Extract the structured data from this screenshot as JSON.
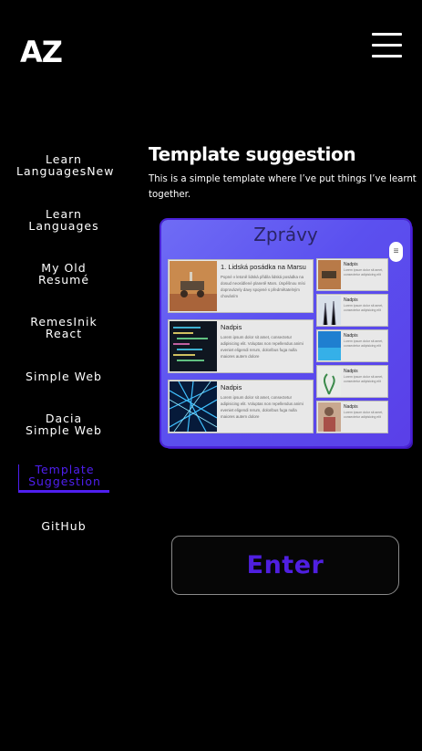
{
  "header": {
    "logo": "AZ",
    "menu_icon": "hamburger-menu-icon"
  },
  "sidenav": {
    "items": [
      {
        "label": "Learn\nLanguagesNew",
        "active": false
      },
      {
        "label": "Learn\nLanguages",
        "active": false
      },
      {
        "label": "My Old\nResumé",
        "active": false
      },
      {
        "label": "RemesInik\nReact",
        "active": false
      },
      {
        "label": "Simple Web",
        "active": false
      },
      {
        "label": "Dacia\nSimple Web",
        "active": false
      },
      {
        "label": "Template\nSuggestion",
        "active": true
      },
      {
        "label": "GitHub",
        "active": false
      }
    ],
    "active_color": "#4f1ff0"
  },
  "main": {
    "title": "Template suggestion",
    "description": "This is a simple template where I’ve put things I’ve learnt together.",
    "preview": {
      "heading": "Zprávy",
      "big_cards": [
        {
          "title": "1. Lidská posádka na Marsu",
          "text": "Popné v letoně lidská přidila lidská posádka na dosud neosídlené planetě Mars. Úspěšnou mísi doprovázely davy spojené s předmětatelným chováním"
        },
        {
          "title": "Nadpis",
          "text": "Lorem ipsum dolor sit amet, consectetur adipisicing elit. Voluptas non repellendus animi eveniet eligendi rerum, doloribus fuga nulla maiores autem dolore"
        },
        {
          "title": "Nadpis",
          "text": "Lorem ipsum dolor sit amet, consectetur adipisicing elit. Voluptas non repellendus animi eveniet eligendi rerum, doloribus fuga nulla maiores autem dolore"
        }
      ],
      "small_cards": [
        {
          "title": "Nadpis",
          "text": "Lorem ipsum dolor sit amet, consectetur adipisicing elit"
        },
        {
          "title": "Nadpis",
          "text": "Lorem ipsum dolor sit amet, consectetur adipisicing elit"
        },
        {
          "title": "Nadpis",
          "text": "Lorem ipsum dolor sit amet, consectetur adipisicing elit"
        },
        {
          "title": "Nadpis",
          "text": "Lorem ipsum dolor sit amet, consectetur adipisicing elit"
        },
        {
          "title": "Nadpis",
          "text": "Lorem ipsum dolor sit amet, consectetur adipisicing elit"
        }
      ]
    },
    "enter_label": "Enter",
    "accent_color": "#4f1fe0"
  }
}
